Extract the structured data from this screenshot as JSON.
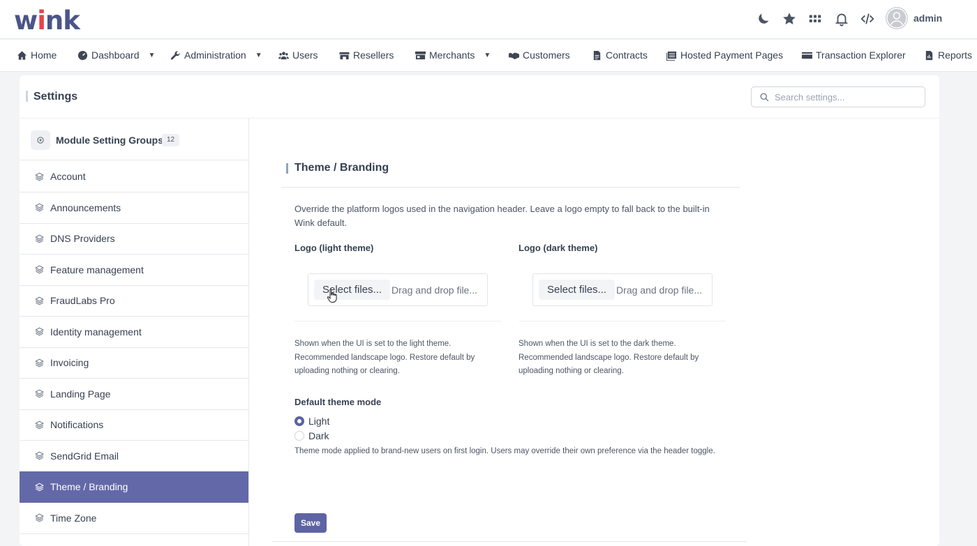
{
  "header": {
    "logo_left": "w",
    "logo_dot": "i",
    "logo_right": "nk",
    "icons": [
      "moon-icon",
      "star-icon",
      "apps-grid-icon",
      "bell-icon",
      "code-icon"
    ],
    "user": "admin"
  },
  "nav": {
    "items": [
      {
        "label": "Home",
        "icon": "home-icon"
      },
      {
        "label": "Dashboard",
        "icon": "dashboard-icon",
        "dropdown": true
      },
      {
        "label": "Administration",
        "icon": "wrench-icon",
        "dropdown": true
      },
      {
        "label": "Users",
        "icon": "users-icon"
      },
      {
        "label": "Resellers",
        "icon": "store-icon"
      },
      {
        "label": "Merchants",
        "icon": "shop-icon",
        "dropdown": true
      },
      {
        "label": "Customers",
        "icon": "handshake-icon"
      },
      {
        "label": "Contracts",
        "icon": "file-icon"
      },
      {
        "label": "Hosted Payment Pages",
        "icon": "pages-icon"
      },
      {
        "label": "Transaction Explorer",
        "icon": "card-icon"
      },
      {
        "label": "Reports",
        "icon": "report-icon"
      }
    ]
  },
  "settings": {
    "title": "Settings",
    "search_placeholder": "Search settings..."
  },
  "sidebar": {
    "header_label": "Module Setting Groups",
    "count": "12",
    "items": [
      {
        "label": "Account"
      },
      {
        "label": "Announcements"
      },
      {
        "label": "DNS Providers"
      },
      {
        "label": "Feature management"
      },
      {
        "label": "FraudLabs Pro"
      },
      {
        "label": "Identity management"
      },
      {
        "label": "Invoicing"
      },
      {
        "label": "Landing Page"
      },
      {
        "label": "Notifications"
      },
      {
        "label": "SendGrid Email"
      },
      {
        "label": "Theme / Branding",
        "active": true
      },
      {
        "label": "Time Zone"
      }
    ]
  },
  "panel": {
    "title": "Theme / Branding",
    "description": "Override the platform logos used in the navigation header. Leave a logo empty to fall back to the built-in Wink default.",
    "logo_light": {
      "label": "Logo (light theme)",
      "button": "Select files...",
      "drop": "Drag and drop file...",
      "hint": "Shown when the UI is set to the light theme. Recommended landscape logo. Restore default by uploading nothing or clearing."
    },
    "logo_dark": {
      "label": "Logo (dark theme)",
      "button": "Select files...",
      "drop": "Drag and drop file...",
      "hint": "Shown when the UI is set to the dark theme. Recommended landscape logo. Restore default by uploading nothing or clearing."
    },
    "theme_mode": {
      "label": "Default theme mode",
      "options": [
        "Light",
        "Dark"
      ],
      "selected": "Light",
      "hint": "Theme mode applied to brand-new users on first login. Users may override their own preference via the header toggle."
    },
    "save": "Save"
  },
  "colors": {
    "brand": "#4b5589",
    "accent": "#e8434a",
    "active": "#6369a8"
  }
}
